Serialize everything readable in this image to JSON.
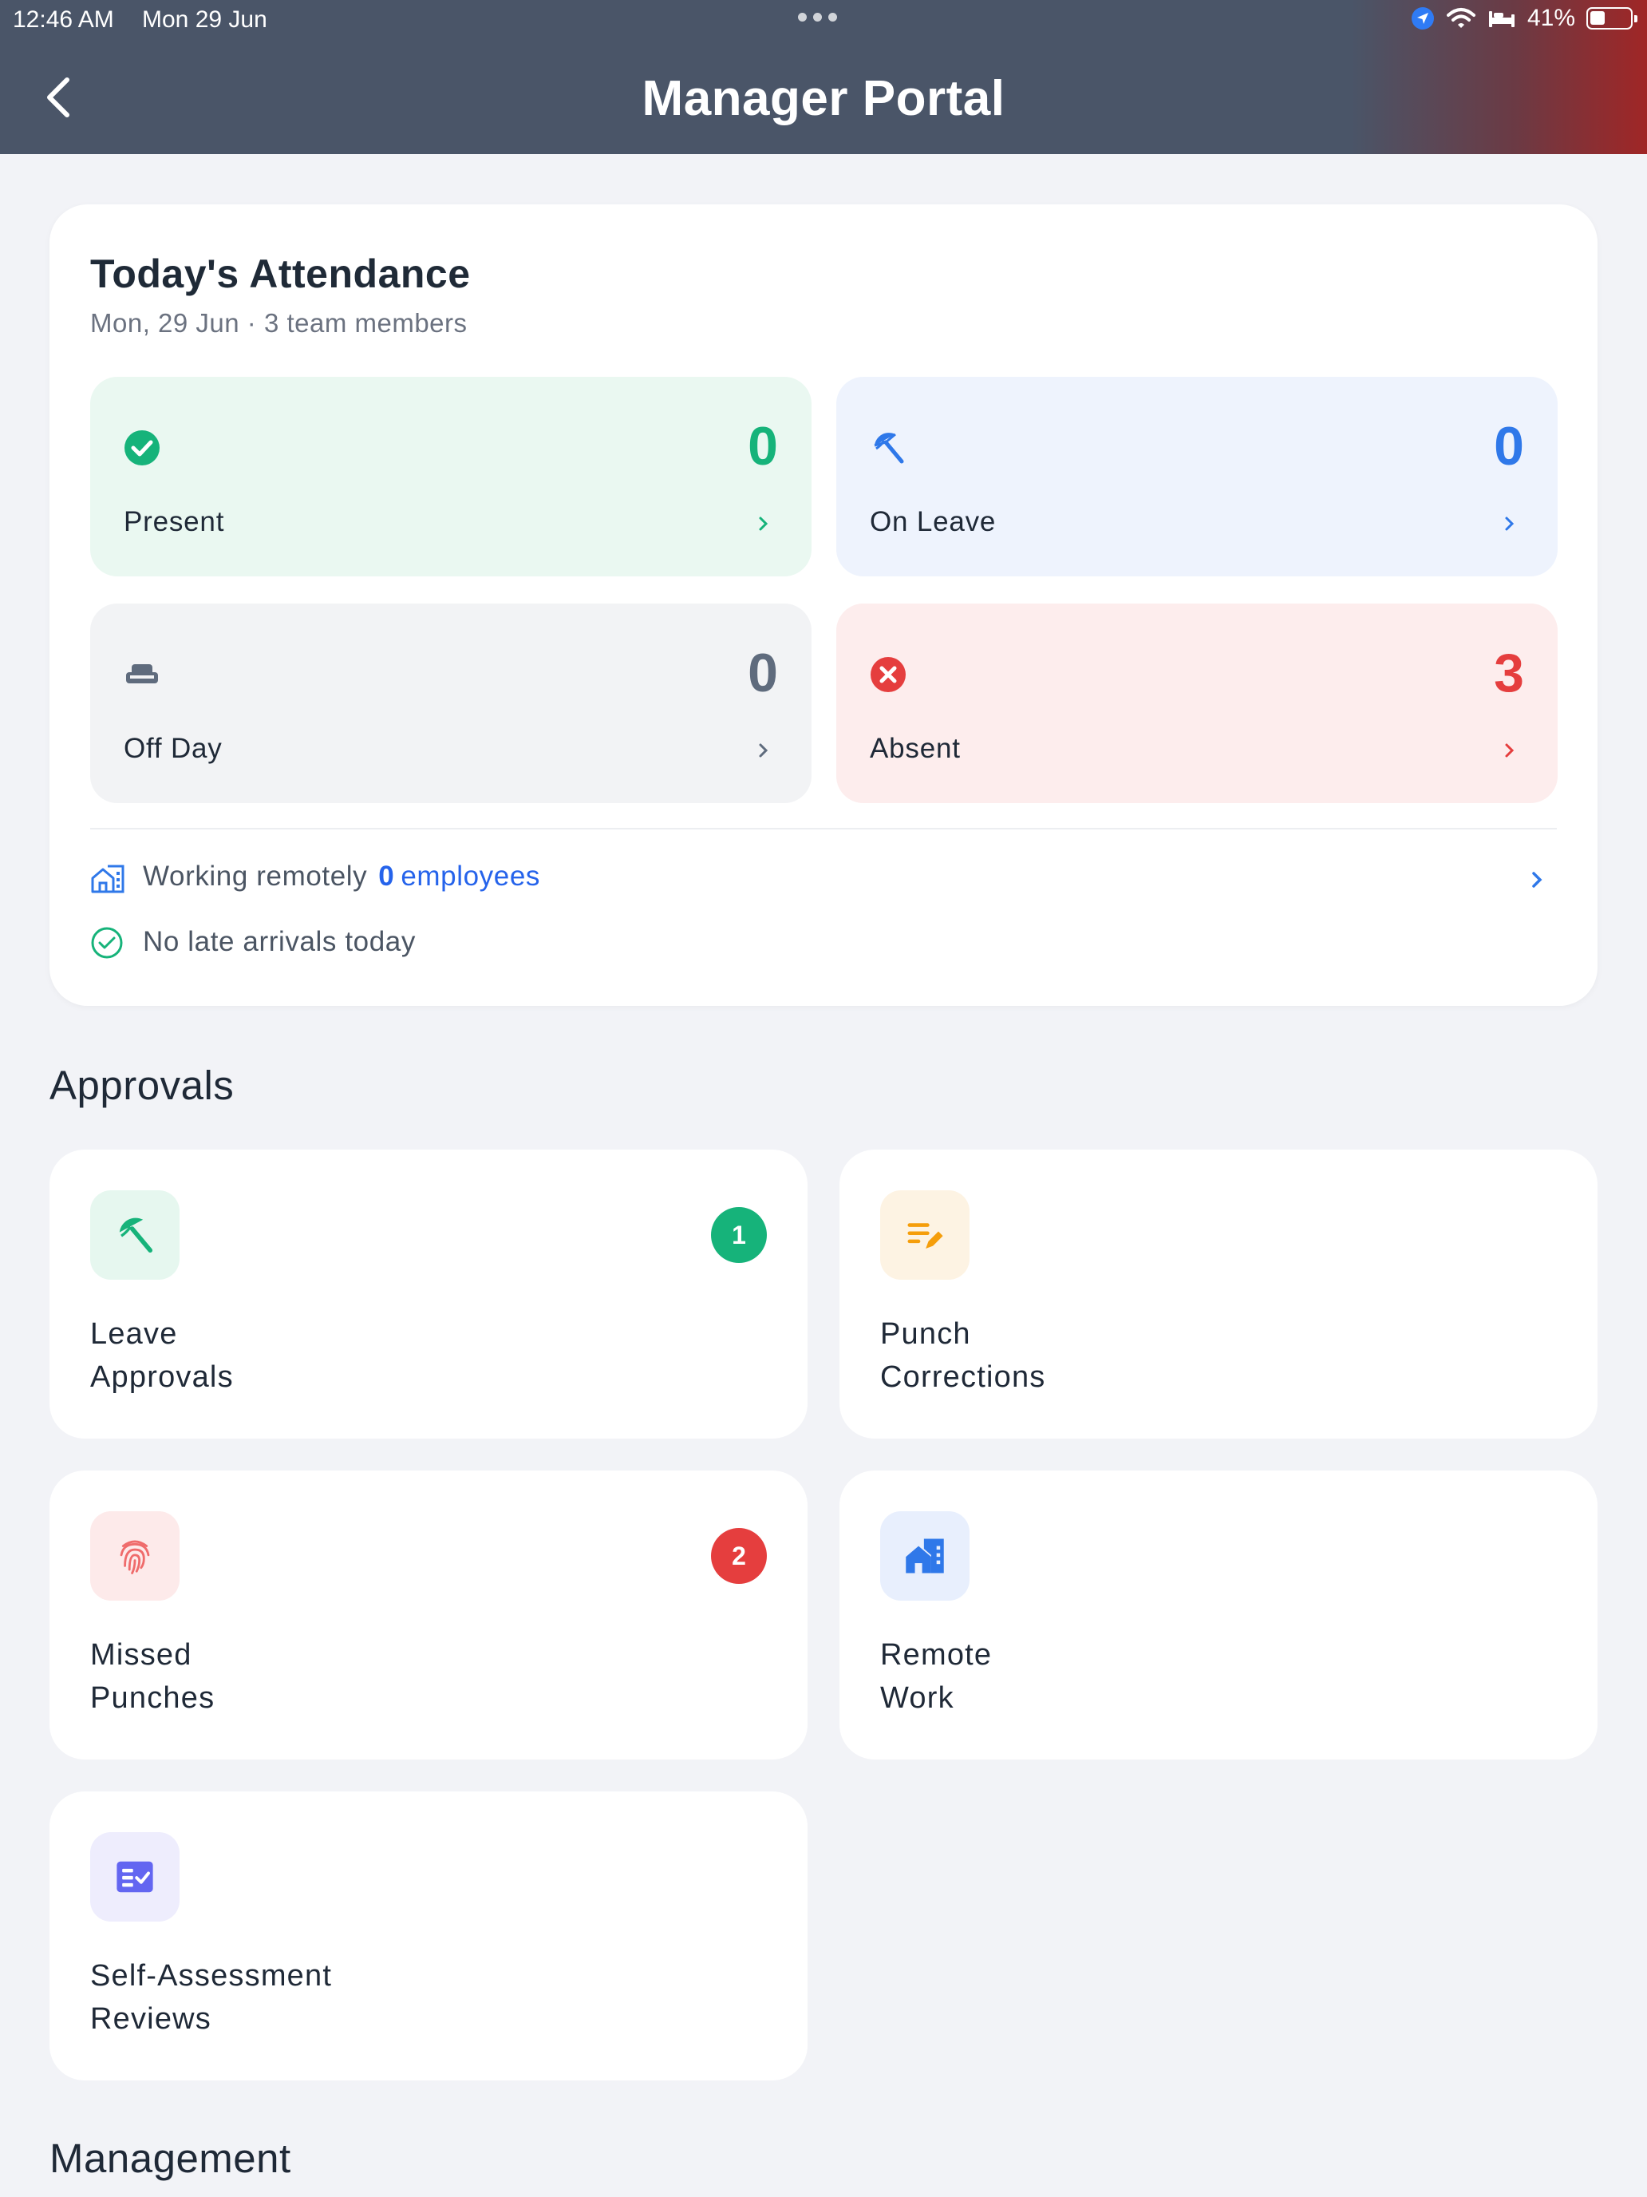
{
  "status_bar": {
    "time": "12:46 AM",
    "date": "Mon 29 Jun",
    "battery": "41%"
  },
  "header": {
    "title": "Manager Portal"
  },
  "attendance": {
    "title": "Today's Attendance",
    "subtitle": "Mon, 29 Jun · 3 team members",
    "tiles": [
      {
        "label": "Present",
        "value": "0",
        "color": "#16b37a",
        "icon": "check-circle-icon"
      },
      {
        "label": "On Leave",
        "value": "0",
        "color": "#2f78e9",
        "icon": "umbrella-icon"
      },
      {
        "label": "Off Day",
        "value": "0",
        "color": "#5f6b7d",
        "icon": "sofa-icon"
      },
      {
        "label": "Absent",
        "value": "3",
        "color": "#e53e3e",
        "icon": "x-circle-icon"
      }
    ],
    "remote": {
      "label": "Working remotely",
      "count": "0",
      "unit": "employees"
    },
    "late": {
      "label": "No late arrivals today"
    }
  },
  "sections": {
    "approvals": "Approvals",
    "management": "Management"
  },
  "approvals": [
    {
      "line1": "Leave",
      "line2": "Approvals",
      "badge": "1",
      "badge_color": "#16b37a",
      "icon": "umbrella-icon"
    },
    {
      "line1": "Punch",
      "line2": "Corrections",
      "badge": "",
      "icon": "edit-list-icon"
    },
    {
      "line1": "Missed",
      "line2": "Punches",
      "badge": "2",
      "badge_color": "#e53e3e",
      "icon": "fingerprint-icon"
    },
    {
      "line1": "Remote",
      "line2": "Work",
      "badge": "",
      "icon": "home-work-icon"
    },
    {
      "line1": "Self-Assessment",
      "line2": "Reviews",
      "badge": "",
      "icon": "checklist-icon"
    }
  ]
}
